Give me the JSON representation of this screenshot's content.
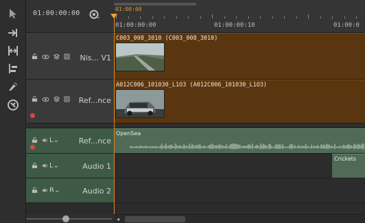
{
  "header": {
    "current_timecode": "01:00:00:00"
  },
  "ruler": {
    "playhead_timecode": "01:00:00",
    "labels": [
      "01:00:00:00",
      "01:00:00:10",
      "01:00:0"
    ]
  },
  "tracks": [
    {
      "kind": "video",
      "name": "Nis... V1",
      "clip_title": "C003_008_3010 (C003_008_3010)",
      "record": false
    },
    {
      "kind": "video",
      "name": "Ref...nce",
      "clip_title": "A012C006_101030_L1O3 (A012C006_101030_L1O3)",
      "record": true
    },
    {
      "kind": "audio",
      "name": "Ref...nce",
      "channel": "L",
      "clip_title": "OpenSea",
      "record": true
    },
    {
      "kind": "audio",
      "name": "Audio 1",
      "channel": "L",
      "clip_title": "Crickets",
      "record": false
    },
    {
      "kind": "audio",
      "name": "Audio 2",
      "channel": "R",
      "clip_title": "",
      "record": false
    }
  ],
  "colors": {
    "video_clip": "#5a3610",
    "audio_clip": "#4f6b57",
    "playhead": "#e08a1c",
    "record": "#d8454a"
  },
  "icons": [
    "select-arrow-icon",
    "ripple-icon",
    "slip-icon",
    "slide-icon",
    "razor-icon",
    "magnet-icon",
    "lock-icon",
    "eye-icon",
    "layers-icon",
    "mute-speaker-icon",
    "snap-icon"
  ]
}
